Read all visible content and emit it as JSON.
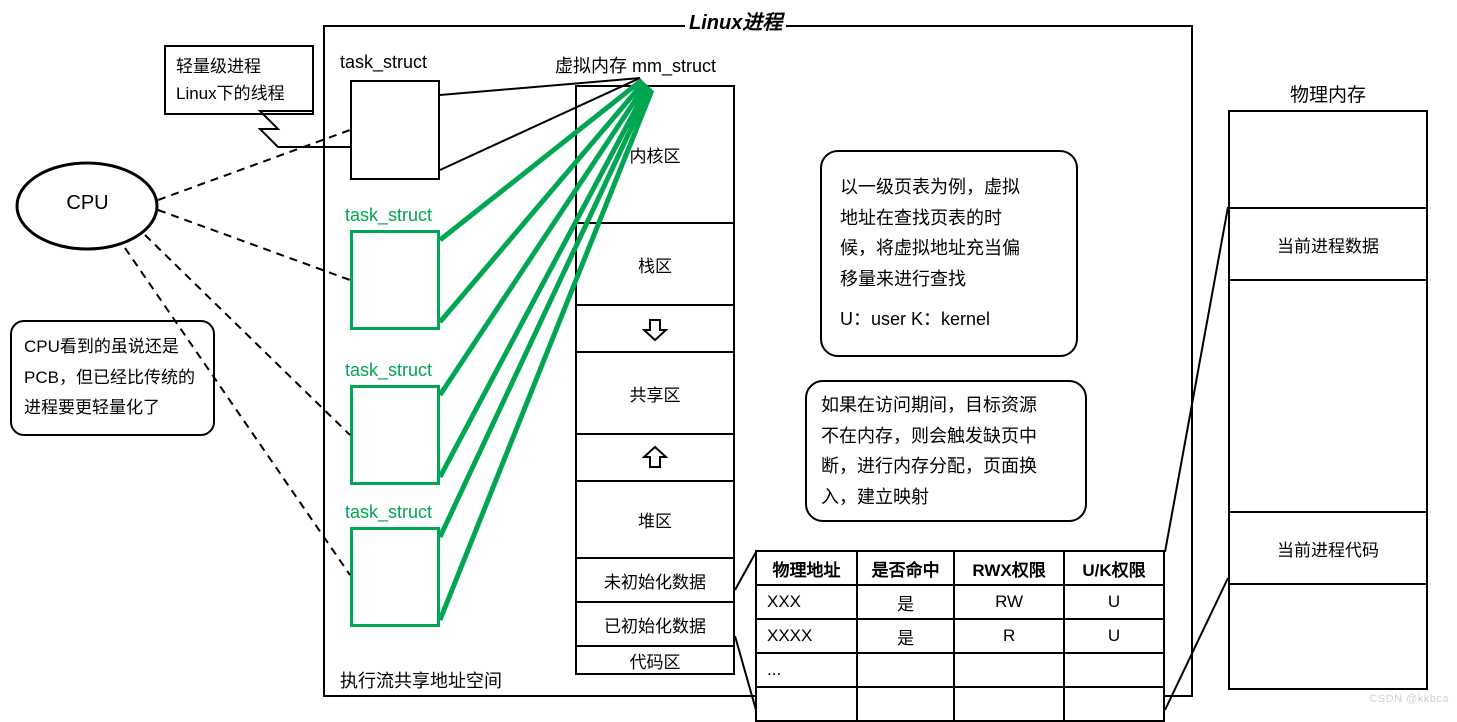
{
  "title": "Linux进程",
  "cpu": {
    "label": "CPU"
  },
  "callout_light": {
    "line1": "轻量级进程",
    "line2": "Linux下的线程"
  },
  "callout_cpu": "CPU看到的虽说还是PCB，但已经比传统的进程要更轻量化了",
  "task_struct": {
    "label_black": "task_struct",
    "label_green": "task_struct"
  },
  "mm_struct": {
    "title": "虚拟内存 mm_struct",
    "rows": [
      "内核区",
      "栈区",
      "",
      "共享区",
      "",
      "堆区",
      "未初始化数据",
      "已初始化数据",
      "代码区"
    ]
  },
  "exec_flow_note": "执行流共享地址空间",
  "note1": {
    "l1": "以一级页表为例，虚拟",
    "l2": "地址在查找页表的时",
    "l3": "候，将虚拟地址充当偏",
    "l4": "移量来进行查找",
    "l5": "U：user  K：kernel"
  },
  "note2": {
    "l1": "如果在访问期间，目标资源",
    "l2": "不在内存，则会触发缺页中",
    "l3": "断，进行内存分配，页面换",
    "l4": "入，建立映射"
  },
  "page_table": {
    "headers": [
      "物理地址",
      "是否命中",
      "RWX权限",
      "U/K权限"
    ],
    "rows": [
      [
        "XXX",
        "是",
        "RW",
        "U"
      ],
      [
        "XXXX",
        "是",
        "R",
        "U"
      ],
      [
        "...",
        "",
        "",
        ""
      ],
      [
        "",
        "",
        "",
        ""
      ]
    ]
  },
  "physical_memory": {
    "title": "物理内存",
    "cur_data": "当前进程数据",
    "cur_code": "当前进程代码"
  },
  "watermark": "CSDN @kkbca"
}
